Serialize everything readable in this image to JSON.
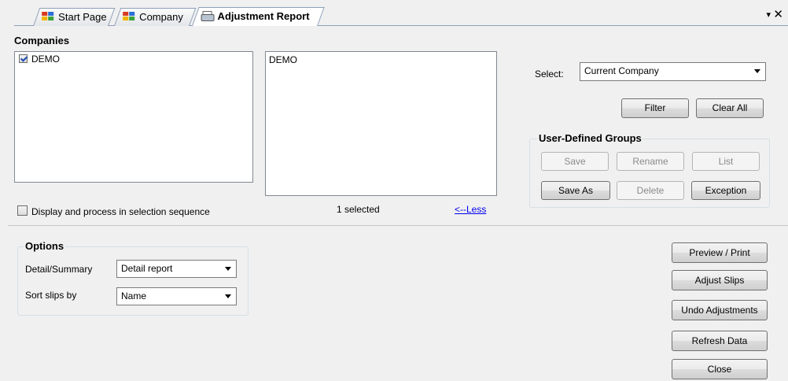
{
  "tabs": [
    {
      "label": "Start Page"
    },
    {
      "label": "Company"
    },
    {
      "label": "Adjustment Report"
    }
  ],
  "tab_controls": {
    "menu": "▾",
    "close": "✕"
  },
  "companies": {
    "label": "Companies",
    "available": [
      {
        "label": "DEMO",
        "checked": true
      }
    ],
    "selected_list": [
      "DEMO"
    ],
    "selected_count": "1 selected",
    "less_link": "<--Less",
    "sequence_checkbox": {
      "label": "Display and process in selection sequence",
      "checked": false
    }
  },
  "select": {
    "label": "Select:",
    "value": "Current Company"
  },
  "filter_button": "Filter",
  "clear_all_button": "Clear All",
  "user_defined_groups": {
    "label": "User-Defined Groups",
    "save": "Save",
    "rename": "Rename",
    "list": "List",
    "save_as": "Save As",
    "delete": "Delete",
    "exception": "Exception"
  },
  "options": {
    "label": "Options",
    "detail_summary_label": "Detail/Summary",
    "detail_summary_value": "Detail report",
    "sort_label": "Sort slips by",
    "sort_value": "Name"
  },
  "actions": {
    "preview_print": "Preview / Print",
    "adjust_slips": "Adjust Slips",
    "undo_adjustments": "Undo Adjustments",
    "refresh_data": "Refresh Data",
    "close": "Close"
  }
}
